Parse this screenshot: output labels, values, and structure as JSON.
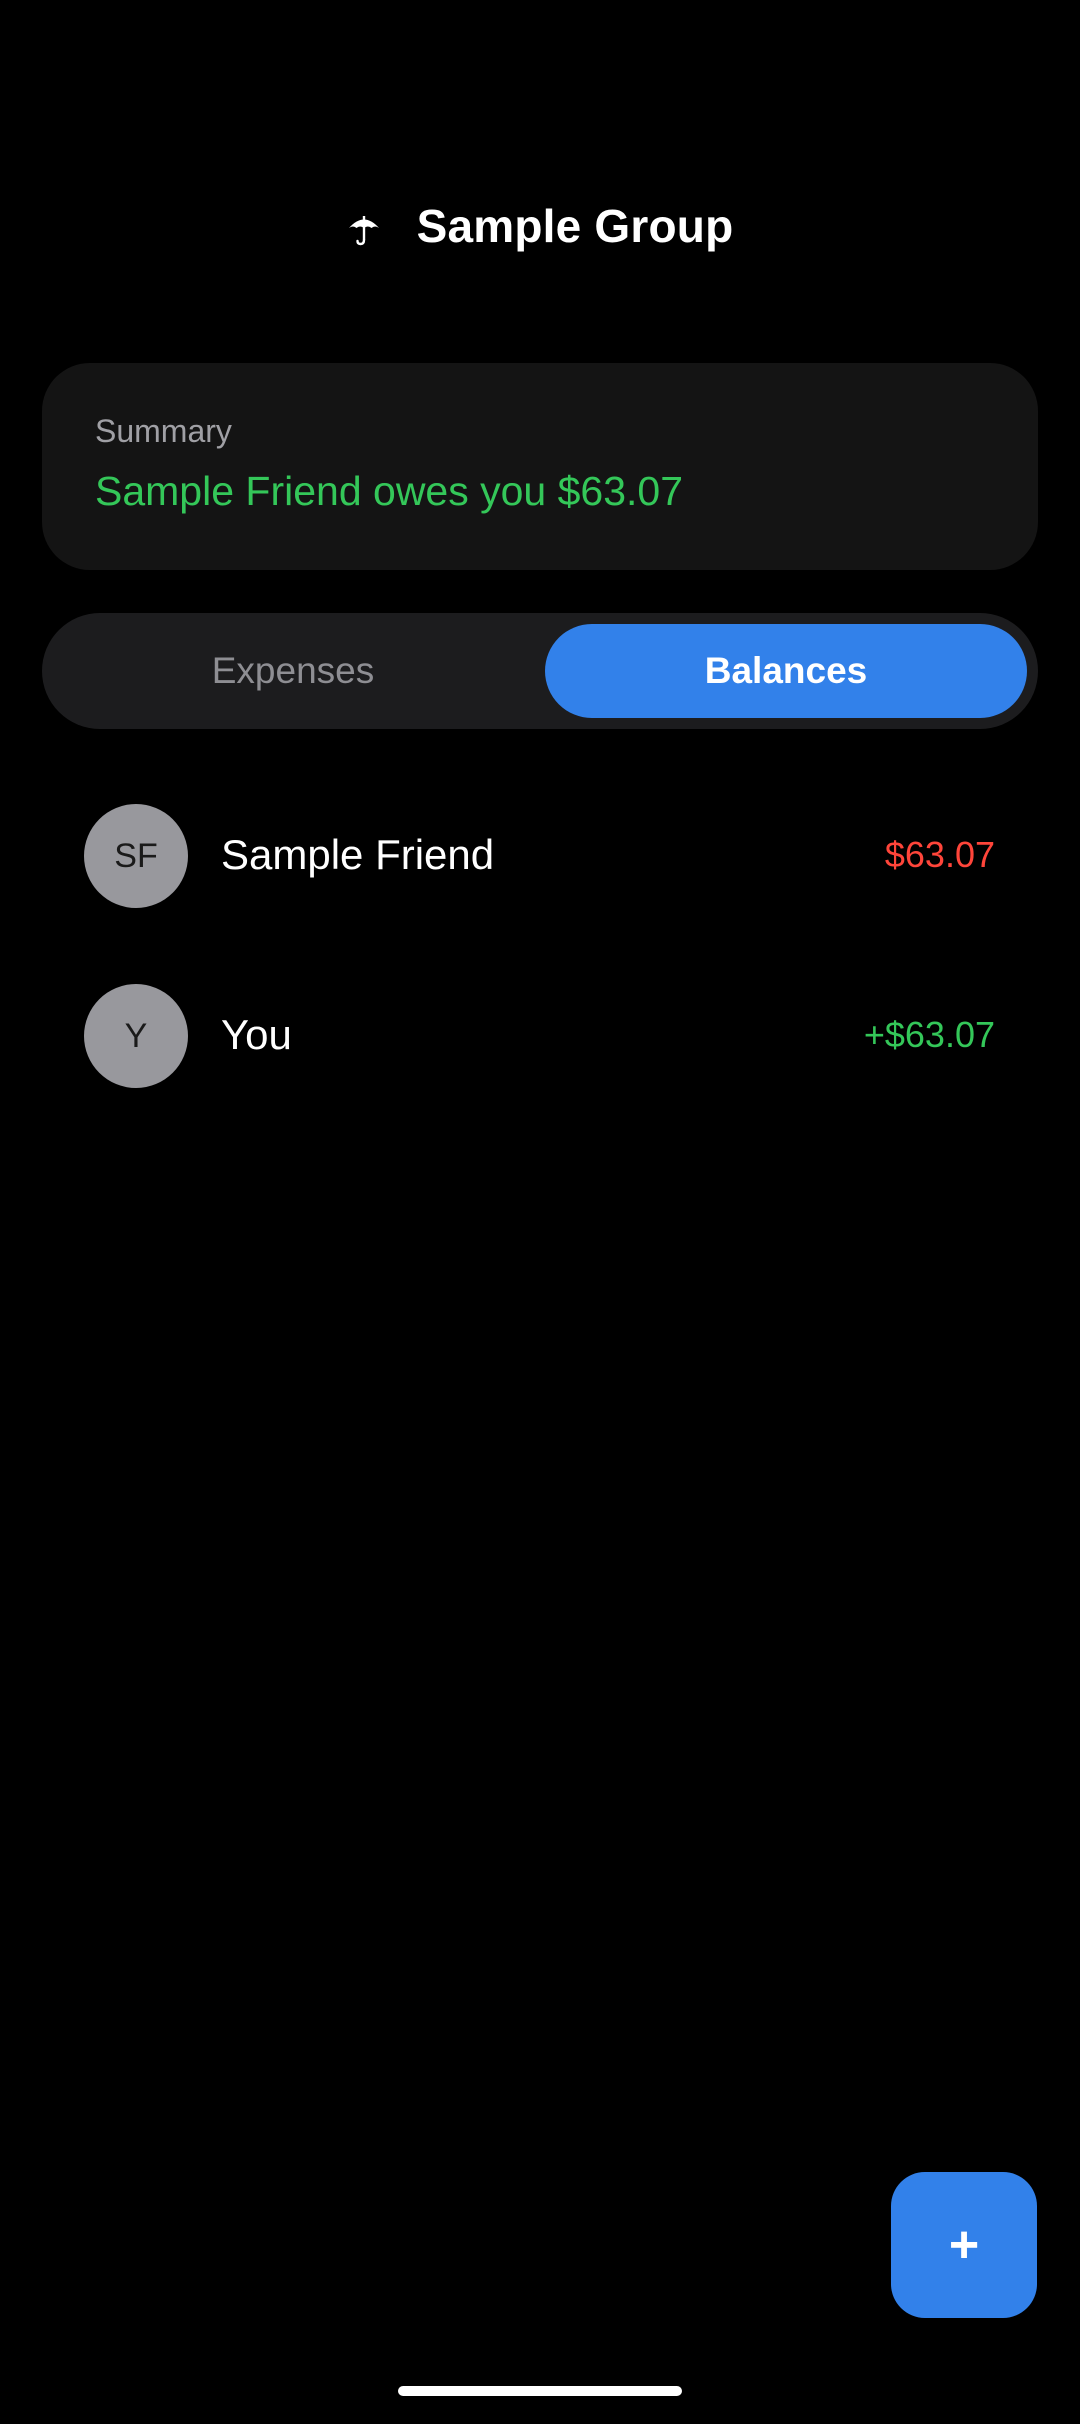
{
  "header": {
    "icon": "umbrella-icon",
    "title": "Sample Group"
  },
  "summary": {
    "label": "Summary",
    "text": "Sample Friend owes you $63.07"
  },
  "tabs": {
    "expenses_label": "Expenses",
    "balances_label": "Balances",
    "selected": "Balances"
  },
  "balances": [
    {
      "initials": "SF",
      "name": "Sample Friend",
      "amount": "$63.07",
      "color": "#ff453a"
    },
    {
      "initials": "Y",
      "name": "You",
      "amount": "+$63.07",
      "color": "#34c759"
    }
  ],
  "fab": {
    "icon": "plus-icon",
    "label": "+"
  },
  "colors": {
    "accent": "#3281ea",
    "positive": "#34c759",
    "negative": "#ff453a",
    "background": "#000000",
    "card": "#141414"
  }
}
